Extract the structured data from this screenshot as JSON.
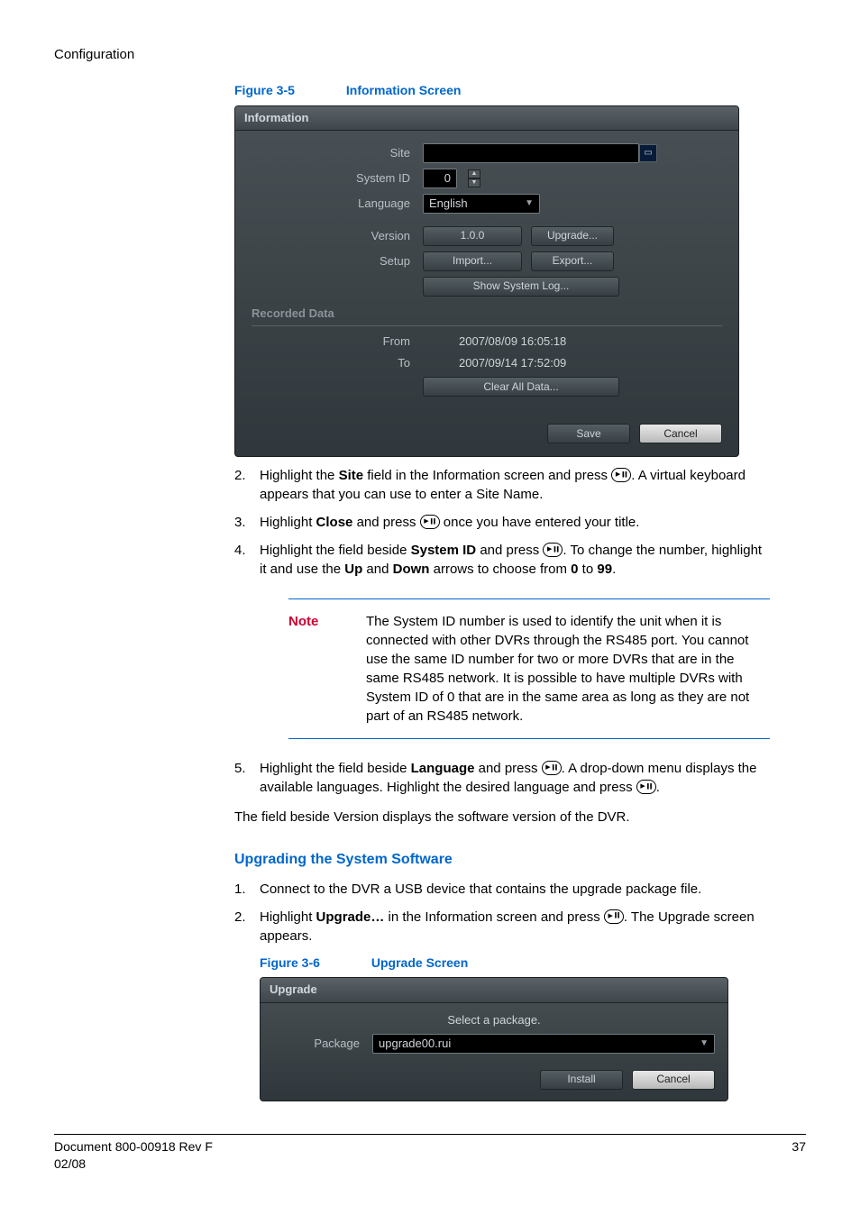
{
  "header": {
    "section": "Configuration"
  },
  "figure35": {
    "number": "Figure 3-5",
    "title": "Information Screen"
  },
  "infoPanel": {
    "title": "Information",
    "labels": {
      "site": "Site",
      "systemId": "System ID",
      "language": "Language",
      "version": "Version",
      "setup": "Setup",
      "recordedData": "Recorded Data",
      "from": "From",
      "to": "To"
    },
    "values": {
      "siteValue": "",
      "systemId": "0",
      "language": "English",
      "version": "1.0.0",
      "from": "2007/08/09  16:05:18",
      "to": "2007/09/14  17:52:09"
    },
    "buttons": {
      "upgrade": "Upgrade...",
      "import": "Import...",
      "export": "Export...",
      "showLog": "Show System Log...",
      "clearAll": "Clear All Data...",
      "save": "Save",
      "cancel": "Cancel"
    }
  },
  "steps1": {
    "n2": "2.",
    "t2a": "Highlight the ",
    "t2b": "Site",
    "t2c": " field in the Information screen and press ",
    "t2d": ". A virtual keyboard appears that you can use to enter a Site Name.",
    "n3": "3.",
    "t3a": "Highlight ",
    "t3b": "Close",
    "t3c": " and press ",
    "t3d": " once you have entered your title.",
    "n4": "4.",
    "t4a": "Highlight the field beside ",
    "t4b": "System ID",
    "t4c": " and press ",
    "t4d": ". To change the number, highlight it and use the ",
    "t4e": "Up",
    "t4f": " and ",
    "t4g": "Down",
    "t4h": " arrows to choose from ",
    "t4i": "0",
    "t4j": " to ",
    "t4k": "99",
    "t4l": "."
  },
  "note": {
    "label": "Note",
    "text": "The System ID number is used to identify the unit when it is connected with other DVRs through the RS485 port. You cannot use the same ID number for two or more DVRs that are in the same RS485 network. It is possible to have multiple DVRs with System ID of 0 that are in the same area as long as they are not part of an RS485 network."
  },
  "step5": {
    "n5": "5.",
    "t5a": "Highlight the field beside ",
    "t5b": "Language",
    "t5c": " and press ",
    "t5d": ". A drop-down menu displays the available languages. Highlight the desired language and press ",
    "t5e": "."
  },
  "paraVersion": "The field beside Version displays the software version of the DVR.",
  "upgradeSection": {
    "heading": "Upgrading the System Software",
    "n1": "1.",
    "t1": "Connect to the DVR a USB device that contains the upgrade package file.",
    "n2": "2.",
    "t2a": "Highlight ",
    "t2b": "Upgrade…",
    "t2c": " in the Information screen and press ",
    "t2d": ". The Upgrade screen appears."
  },
  "figure36": {
    "number": "Figure 3-6",
    "title": "Upgrade Screen"
  },
  "upgradePanel": {
    "title": "Upgrade",
    "prompt": "Select a package.",
    "labels": {
      "package": "Package"
    },
    "values": {
      "package": "upgrade00.rui"
    },
    "buttons": {
      "install": "Install",
      "cancel": "Cancel"
    }
  },
  "footer": {
    "left1": "Document 800-00918 Rev F",
    "left2": "02/08",
    "pageNum": "37"
  }
}
